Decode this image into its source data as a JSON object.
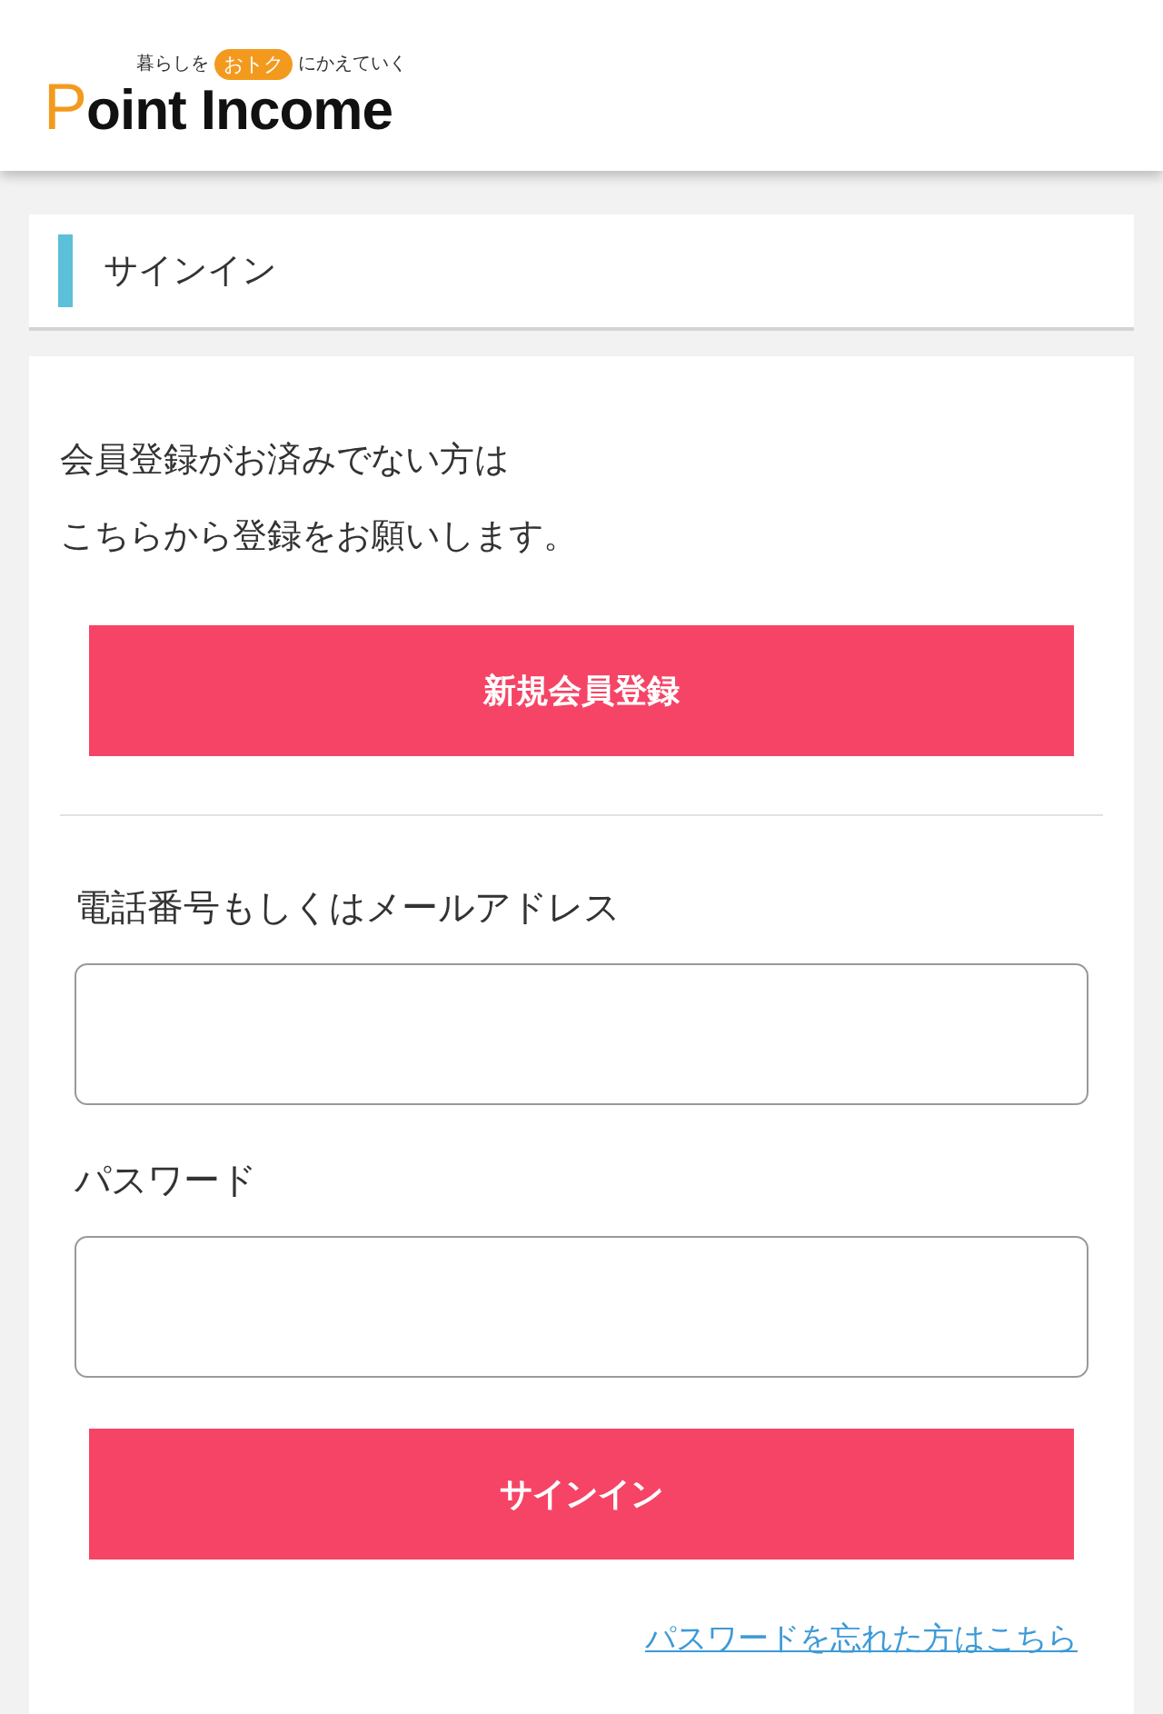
{
  "header": {
    "tagline_before": "暮らしを",
    "tagline_badge": "おトク",
    "tagline_after": "にかえていく",
    "logo": "Point Income"
  },
  "section_title": "サインイン",
  "intro_lines": [
    "会員登録がお済みでない方は",
    "こちらから登録をお願いします。"
  ],
  "register_button": "新規会員登録",
  "fields": [
    {
      "label": "電話番号もしくはメールアドレス"
    },
    {
      "label": "パスワード"
    }
  ],
  "signin_button": "サインイン",
  "forgot_link": "パスワードを忘れた方はこちら"
}
